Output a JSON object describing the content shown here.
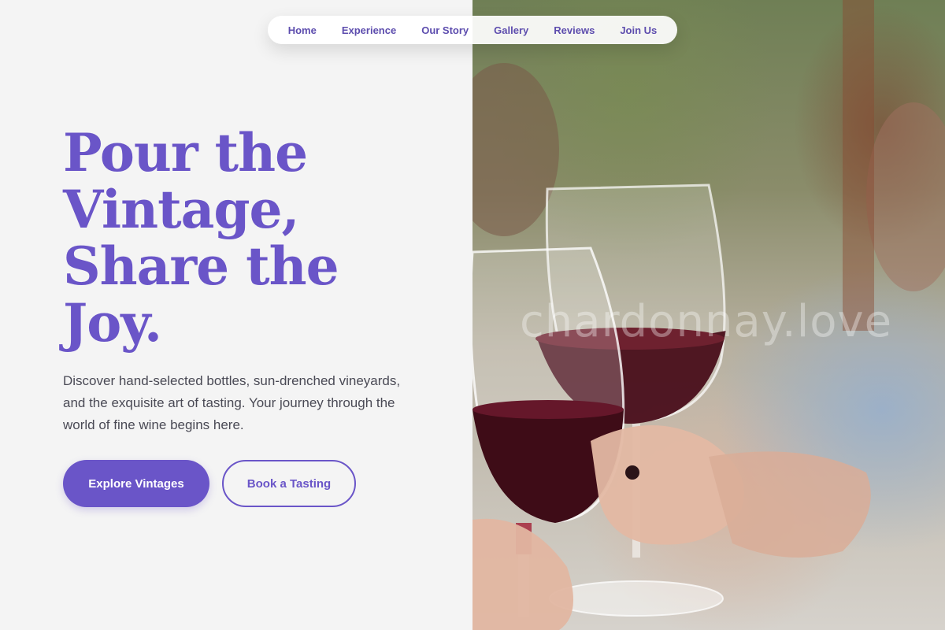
{
  "nav": {
    "items": [
      "Home",
      "Experience",
      "Our Story",
      "Gallery",
      "Reviews",
      "Join Us"
    ]
  },
  "hero": {
    "headline_lines": [
      "Pour the",
      "Vintage,",
      "Share the",
      "Joy."
    ],
    "subtext": "Discover hand-selected bottles, sun-drenched vineyards, and the exquisite art of tasting. Your journey through the world of fine wine begins here.",
    "primary_button": "Explore Vintages",
    "secondary_button": "Book a Tasting"
  },
  "photo": {
    "watermark": "chardonnay.love"
  },
  "colors": {
    "accent": "#6a55c8",
    "background": "#f4f4f4",
    "wine": "#4a0f1c"
  }
}
